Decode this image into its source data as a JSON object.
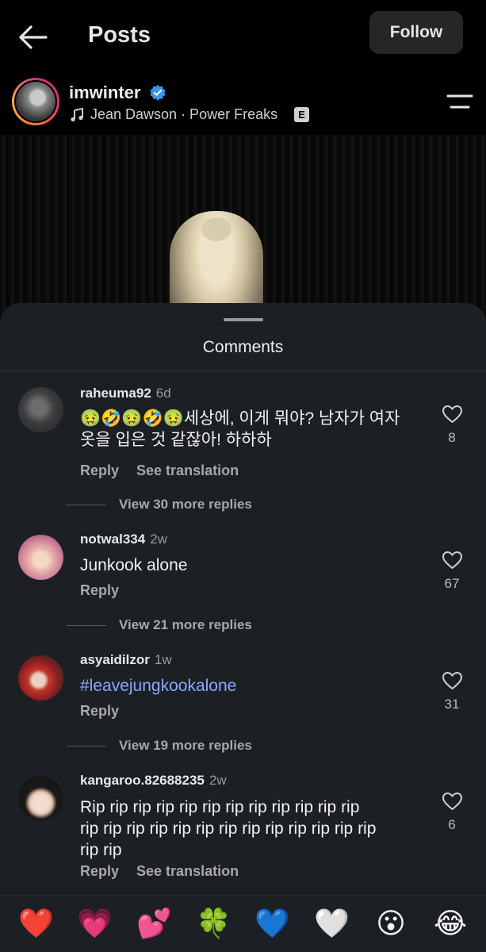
{
  "header": {
    "title": "Posts",
    "follow_label": "Follow"
  },
  "author": {
    "username": "imwinter",
    "music": "Jean Dawson · Power Freaks",
    "explicit": "E"
  },
  "comments_sheet": {
    "title": "Comments",
    "reply_label": "Reply",
    "see_translation_label": "See translation"
  },
  "comments": [
    {
      "username": "raheuma92",
      "time": "6d",
      "text_line1": "🤢🤣🤢🤣🤢세상에, 이게 뭐야? 남자가 여자",
      "text_line2": "옷을 입은 것 같잖아! 하하하",
      "likes": "8",
      "view_replies": "View 30 more replies"
    },
    {
      "username": "notwal334",
      "time": "2w",
      "text": "Junkook alone",
      "likes": "67",
      "view_replies": "View 21 more replies"
    },
    {
      "username": "asyaidilzor",
      "time": "1w",
      "text": "#leavejungkookalone",
      "likes": "31",
      "view_replies": "View 19 more replies"
    },
    {
      "username": "kangaroo.82688235",
      "time": "2w",
      "text_line1": "Rip rip rip rip rip rip rip rip rip rip rip rip",
      "text_line2": "rip rip rip rip rip rip rip rip rip rip rip rip rip",
      "text_line3": "rip rip",
      "likes": "6"
    }
  ],
  "emoji_bar": [
    "❤️",
    "💗",
    "💕",
    "🍀",
    "💙",
    "🤍",
    "😮",
    "😂"
  ]
}
